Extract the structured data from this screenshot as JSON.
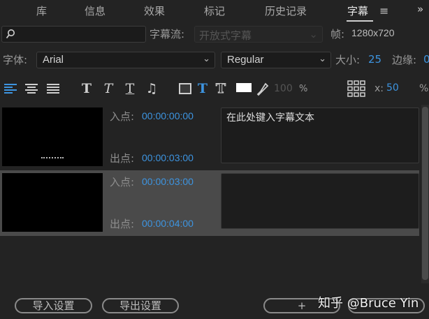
{
  "tabs": {
    "library": "库",
    "info": "信息",
    "effects": "效果",
    "markers": "标记",
    "history": "历史记录",
    "captions": "字幕",
    "more": "»"
  },
  "search": {
    "placeholder": "",
    "value": ""
  },
  "caption_stream": {
    "label": "字幕流:",
    "value": "开放式字幕"
  },
  "frame": {
    "label": "帧:",
    "value": "1280x720"
  },
  "font": {
    "label": "字体:",
    "family": "Arial",
    "style": "Regular",
    "size_label": "大小:",
    "size": "25",
    "edge_label": "边缘:",
    "edge_value": "0"
  },
  "toolbar": {
    "opacity": "100",
    "percent": "%",
    "x_label": "x:",
    "x_value": "50",
    "x_percent": "%"
  },
  "captions_list": [
    {
      "in_label": "入点:",
      "in_time": "00:00:00:00",
      "out_label": "出点:",
      "out_time": "00:00:03:00",
      "text": "在此处键入字幕文本"
    },
    {
      "in_label": "入点:",
      "in_time": "00:00:03:00",
      "out_label": "出点:",
      "out_time": "00:00:04:00",
      "text": ""
    }
  ],
  "buttons": {
    "import_settings": "导入设置",
    "export_settings": "导出设置",
    "add": "+"
  },
  "watermark": "知乎 @Bruce Yin",
  "colors": {
    "accent": "#3d94e0",
    "panel_bg": "#232323",
    "selected_row": "#4a4a4a"
  }
}
